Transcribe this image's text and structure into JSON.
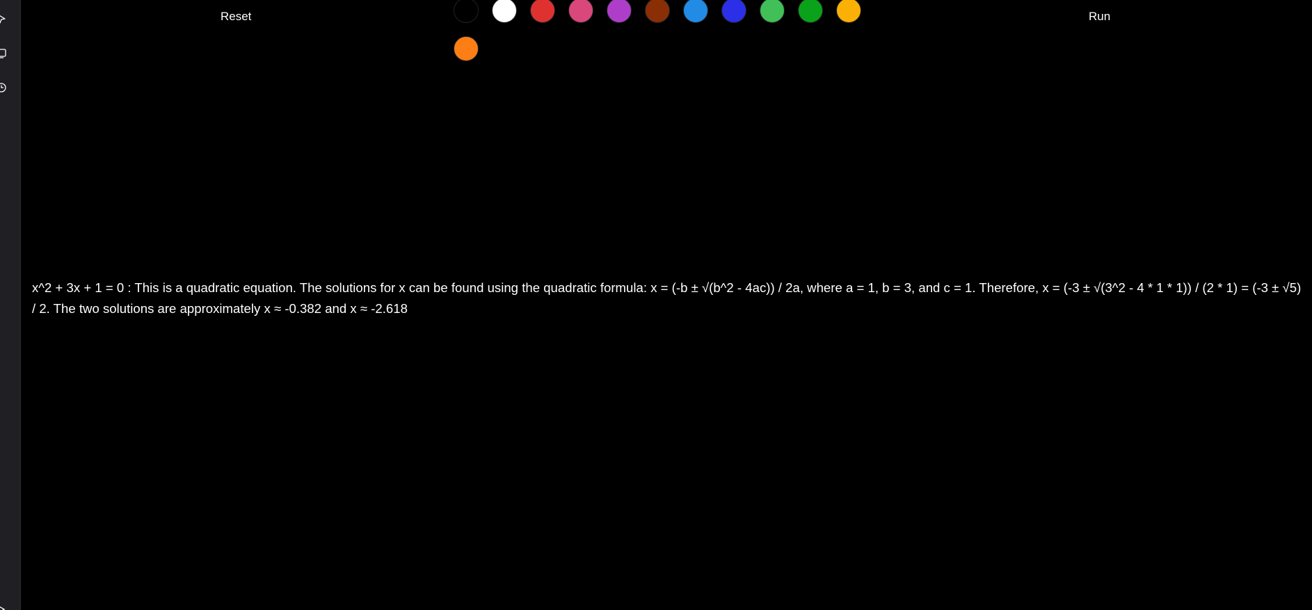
{
  "toolbar": {
    "reset_label": "Reset",
    "run_label": "Run"
  },
  "palette": [
    {
      "name": "black",
      "color": "#000000"
    },
    {
      "name": "white",
      "color": "#ffffff"
    },
    {
      "name": "red",
      "color": "#e03131"
    },
    {
      "name": "pink",
      "color": "#d9477b"
    },
    {
      "name": "purple",
      "color": "#ae3ec9"
    },
    {
      "name": "brown",
      "color": "#8a2e06"
    },
    {
      "name": "light-blue",
      "color": "#228be6"
    },
    {
      "name": "blue",
      "color": "#2b2fe8"
    },
    {
      "name": "light-green",
      "color": "#40c057"
    },
    {
      "name": "green",
      "color": "#0aa21a"
    },
    {
      "name": "yellow",
      "color": "#fab005"
    },
    {
      "name": "orange",
      "color": "#fd7e14"
    }
  ],
  "result": {
    "text": "x^2 + 3x + 1 = 0 : This is a quadratic equation. The solutions for x can be found using the quadratic formula: x = (-b ± √(b^2 - 4ac)) / 2a, where a = 1, b = 3, and c = 1. Therefore, x = (-3 ± √(3^2 - 4 * 1 * 1)) / (2 * 1) = (-3 ± √5) / 2. The two solutions are approximately x ≈ -0.382 and x ≈ -2.618"
  },
  "sidebar": {
    "icons": [
      "pointer-icon",
      "copy-icon",
      "history-icon",
      "expand-icon"
    ]
  }
}
